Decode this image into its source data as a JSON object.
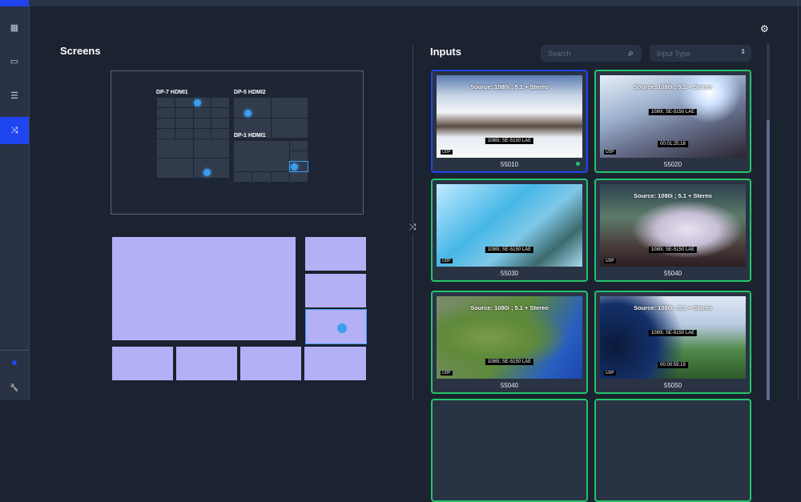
{
  "sidebar": {
    "items": [
      {
        "icon": "grid-icon",
        "glyph": "▦"
      },
      {
        "icon": "monitor-icon",
        "glyph": "▭"
      },
      {
        "icon": "server-icon",
        "glyph": "☰"
      },
      {
        "icon": "shuffle-icon",
        "glyph": "⤨",
        "active": true
      }
    ],
    "bottom": [
      {
        "icon": "status-dot-icon"
      },
      {
        "icon": "wrench-icon",
        "glyph": "🔧"
      }
    ]
  },
  "screens": {
    "title": "Screens",
    "displays": [
      {
        "label": "DP-7 HDMI1"
      },
      {
        "label": "DP-5 HDMI2"
      },
      {
        "label": "DP-1 HDMI1"
      }
    ]
  },
  "inputs": {
    "title": "Inputs",
    "search_placeholder": "Search",
    "type_placeholder": "Input Type",
    "cards": [
      {
        "id": "55010",
        "source": "Source: 1080i ; 5.1 + Stereo",
        "caption": "1080i; SE-5150 LAE",
        "time": "",
        "selected": true,
        "live": true
      },
      {
        "id": "55020",
        "source": "Source: 1080i ; 5.1 + Stereo",
        "caption": "1080i; SE-5150 LAE",
        "time": "00:01:25;18",
        "selected": false
      },
      {
        "id": "55030",
        "source": "",
        "caption": "1080i; SE-5150 LAE",
        "time": "",
        "selected": false
      },
      {
        "id": "55040",
        "source": "Source: 1080i ; 5.1 + Stereo",
        "caption": "1080i; SE-5150 LAE",
        "time": "",
        "selected": false
      },
      {
        "id": "55040",
        "source": "Source: 1080i ; 5.1 + Stereo",
        "caption": "1080i; SE-5150 LAE",
        "time": "",
        "selected": false
      },
      {
        "id": "55050",
        "source": "Source: 1080i ; 5.1 + Stereo",
        "caption": "1080i; SE-5150 LAE",
        "time": "00:00:59;19",
        "selected": false
      }
    ],
    "udp_label": "UDP"
  },
  "colors": {
    "accent": "#1f45f0",
    "live": "#23c46b",
    "layout_tile": "#b3b0f5"
  }
}
